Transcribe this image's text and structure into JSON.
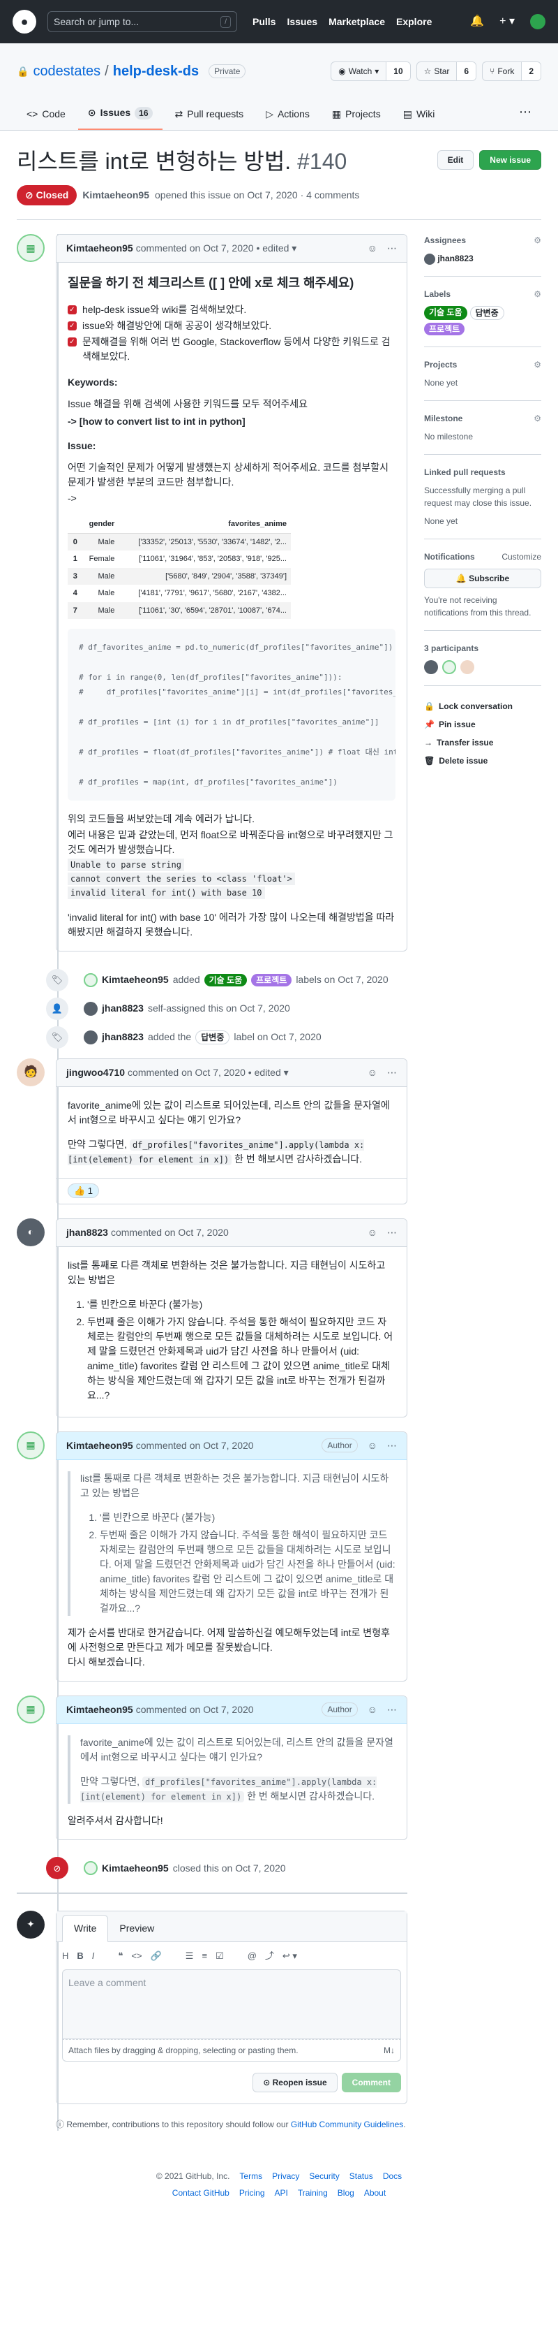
{
  "header": {
    "search_placeholder": "Search or jump to...",
    "slash": "/",
    "nav": [
      "Pulls",
      "Issues",
      "Marketplace",
      "Explore"
    ]
  },
  "repo": {
    "owner": "codestates",
    "name": "help-desk-ds",
    "visibility": "Private",
    "watch_label": "Watch",
    "watch_count": "10",
    "star_label": "Star",
    "star_count": "6",
    "fork_label": "Fork",
    "fork_count": "2",
    "tabs": [
      {
        "label": "Code"
      },
      {
        "label": "Issues",
        "count": "16"
      },
      {
        "label": "Pull requests"
      },
      {
        "label": "Actions"
      },
      {
        "label": "Projects"
      },
      {
        "label": "Wiki"
      }
    ]
  },
  "issue": {
    "title": "리스트를 int로 변형하는 방법.",
    "number": "#140",
    "edit_label": "Edit",
    "new_label": "New issue",
    "state": "Closed",
    "author": "Kimtaeheon95",
    "meta": "opened this issue on Oct 7, 2020 · 4 comments"
  },
  "c1": {
    "author": "Kimtaeheon95",
    "meta": "commented on Oct 7, 2020",
    "edited": "• edited ▾",
    "heading": "질문을 하기 전 체크리스트 ([ ] 안에 x로 체크 해주세요)",
    "tasks": [
      "help-desk issue와 wiki를 검색해보았다.",
      "issue와 해결방안에 대해 공공이 생각해보았다.",
      "문제해결을 위해 여러 번 Google, Stackoverflow 등에서 다양한 키워드로 검색해보았다."
    ],
    "kw_title": "Keywords:",
    "kw_line1": "Issue 해결을 위해 검색에 사용한 키워드를 모두 적어주세요",
    "kw_line2": "-> [how to convert list to int in python]",
    "issue_title": "Issue:",
    "issue_text": "어떤 기술적인 문제가 어떻게 발생했는지 상세하게 적어주세요. 코드를 첨부할시 문제가 발생한 부분의 코드만 첨부합니다.",
    "arrow": "->",
    "table_head": [
      "",
      "gender",
      "favorites_anime"
    ],
    "table_rows": [
      [
        "0",
        "Male",
        "['33352', '25013', '5530', '33674', '1482', '2..."
      ],
      [
        "1",
        "Female",
        "['11061', '31964', '853', '20583', '918', '925..."
      ],
      [
        "3",
        "Male",
        "['5680', '849', '2904', '3588', '37349']"
      ],
      [
        "4",
        "Male",
        "['4181', '7791', '9617', '5680', '2167', '4382..."
      ],
      [
        "7",
        "Male",
        "['11061', '30', '6594', '28701', '10087', '674..."
      ]
    ],
    "code": "# df_favorites_anime = pd.to_numeric(df_profiles[\"favorites_anime\"])\n\n# for i in range(0, len(df_profiles[\"favorites_anime\"])):\n#     df_profiles[\"favorites_anime\"][i] = int(df_profiles[\"favorites_anime\"][i])\n\n# df_profiles = [int (i) for i in df_profiles[\"favorites_anime\"]]\n\n# df_profiles = float(df_profiles[\"favorites_anime\"]) # float 대신 int\n\n# df_profiles = map(int, df_profiles[\"favorites_anime\"])",
    "p1": "위의 코드들을 써보았는데 계속 에러가 납니다.",
    "p2": "에러 내용은 밑과 같았는데, 먼저 float으로 바꿔준다음 int형으로 바꾸려했지만 그것도 에러가 발생했습니다.",
    "errors": [
      "Unable to parse string",
      "cannot convert the series to <class 'float'>",
      "invalid literal for int() with base 10"
    ],
    "p3": "'invalid literal for int() with base 10' 에러가 가장 많이 나오는데 해결방법을 따라해봤지만 해결하지 못했습니다."
  },
  "ev1": {
    "user": "Kimtaeheon95",
    "action": "added",
    "labels": [
      "기술 도움",
      "프로젝트"
    ],
    "suffix": "labels on Oct 7, 2020"
  },
  "ev2": {
    "user": "jhan8823",
    "text": "self-assigned this on Oct 7, 2020"
  },
  "ev3": {
    "user": "jhan8823",
    "action": "added the",
    "label": "답변중",
    "suffix": "label on Oct 7, 2020"
  },
  "c2": {
    "author": "jingwoo4710",
    "meta": "commented on Oct 7, 2020",
    "edited": "• edited ▾",
    "p1": "favorite_anime에 있는 값이 리스트로 되어있는데, 리스트 안의 값들을 문자열에서 int형으로 바꾸시고 싶다는 얘기 인가요?",
    "p2a": "만약 그렇다면, ",
    "code": "df_profiles[\"favorites_anime\"].apply(lambda x: [int(element) for element in x])",
    "p2b": " 한 번 해보시면 감사하겠습니다.",
    "reaction": "👍 1"
  },
  "c3": {
    "author": "jhan8823",
    "meta": "commented on Oct 7, 2020",
    "p1": "list를 통째로 다른 객체로 변환하는 것은 불가능합니다. 지금 태현님이 시도하고 있는 방법은",
    "items": [
      "'를 빈칸으로 바꾼다 (불가능)",
      "두번째 줄은 이해가 가지 않습니다. 주석을 통한 해석이 필요하지만 코드 자체로는 칼럼안의 두번째 행으로 모든 값들을 대체하려는 시도로 보입니다. 어제 말을 드렸던건 안화제목과 uid가 담긴 사전을 하나 만들어서 (uid: anime_title) favorites 칼럼 안 리스트에 그 값이 있으면 anime_title로 대체하는 방식을 제안드렸는데 왜 갑자기 모든 값을 int로 바꾸는 전개가 된걸까요...?"
    ]
  },
  "c4": {
    "author": "Kimtaeheon95",
    "meta": "commented on Oct 7, 2020",
    "badge": "Author",
    "q1": "list를 통째로 다른 객체로 변환하는 것은 불가능합니다. 지금 태현님이 시도하고 있는 방법은",
    "items": [
      "'를 빈칸으로 바꾼다 (불가능)",
      "두번째 줄은 이해가 가지 않습니다. 주석을 통한 해석이 필요하지만 코드 자체로는 칼럼안의 두번째 행으로 모든 값들을 대체하려는 시도로 보입니다. 어제 말을 드렸던건 안화제목과 uid가 담긴 사전을 하나 만들어서 (uid: anime_title) favorites 칼럼 안 리스트에 그 값이 있으면 anime_title로 대체하는 방식을 제안드렸는데 왜 갑자기 모든 값을 int로 바꾸는 전개가 된걸까요...?"
    ],
    "p1": "제가 순서를 반대로 한거같습니다. 어제 말씀하신걸 예모해두었는데 int로 변형후에 사전형으로 만든다고 제가 메모를 잘못봤습니다.",
    "p2": "다시 해보겠습니다."
  },
  "c5": {
    "author": "Kimtaeheon95",
    "meta": "commented on Oct 7, 2020",
    "badge": "Author",
    "q1": "favorite_anime에 있는 값이 리스트로 되어있는데, 리스트 안의 값들을 문자열에서 int형으로 바꾸시고 싶다는 얘기 인가요?",
    "q2a": "만약 그렇다면, ",
    "code": "df_profiles[\"favorites_anime\"].apply(lambda x: [int(element) for element in x])",
    "q2b": " 한 번 해보시면 감사하겠습니다.",
    "p1": "알려주셔서 감사합니다!"
  },
  "ev4": {
    "user": "Kimtaeheon95",
    "text": "closed this on Oct 7, 2020"
  },
  "editor": {
    "tab_write": "Write",
    "tab_preview": "Preview",
    "placeholder": "Leave a comment",
    "attach": "Attach files by dragging & dropping, selecting or pasting them.",
    "reopen": "Reopen issue",
    "comment": "Comment",
    "remember_a": "Remember, contributions to this repository should follow our ",
    "remember_link": "GitHub Community Guidelines",
    "remember_b": "."
  },
  "sidebar": {
    "assignees": "Assignees",
    "assignee": "jhan8823",
    "labels_title": "Labels",
    "labels": [
      "기술 도움",
      "답변중",
      "프로젝트"
    ],
    "projects": "Projects",
    "projects_val": "None yet",
    "milestone": "Milestone",
    "milestone_val": "No milestone",
    "linked": "Linked pull requests",
    "linked_desc": "Successfully merging a pull request may close this issue.",
    "linked_val": "None yet",
    "notif": "Notifications",
    "customize": "Customize",
    "subscribe": "🔔 Subscribe",
    "notif_desc": "You're not receiving notifications from this thread.",
    "participants": "3 participants",
    "lock": "Lock conversation",
    "pin": "Pin issue",
    "transfer": "Transfer issue",
    "delete": "Delete issue"
  },
  "footer": {
    "copyright": "© 2021 GitHub, Inc.",
    "row1": [
      "Terms",
      "Privacy",
      "Security",
      "Status",
      "Docs"
    ],
    "row2": [
      "Contact GitHub",
      "Pricing",
      "API",
      "Training",
      "Blog",
      "About"
    ]
  }
}
